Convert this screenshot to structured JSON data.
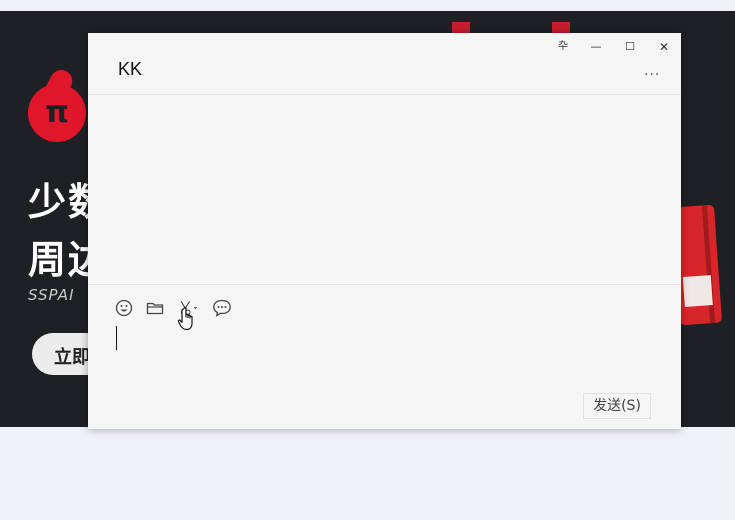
{
  "background_page": {
    "logo_glyph": "π",
    "headline_line1": "少数",
    "headline_line2": "周边",
    "brand": "SSPAI",
    "cta_label": "立即"
  },
  "chat_window": {
    "title": "KK",
    "window_controls": {
      "pin_icon": "pin-icon",
      "minimize_icon": "minimize-icon",
      "maximize_icon": "maximize-icon",
      "close_icon": "close-icon",
      "pin_glyph": "卆",
      "minimize_glyph": "—",
      "maximize_glyph": "☐",
      "close_glyph": "✕"
    },
    "more_label": "...",
    "toolbar": [
      {
        "name": "emoji-icon"
      },
      {
        "name": "folder-icon"
      },
      {
        "name": "scissors-icon"
      },
      {
        "name": "chat-bubble-icon"
      }
    ],
    "input_value": "",
    "send_label": "发送(S)"
  },
  "colors": {
    "brand_red": "#e0162b",
    "banner_bg": "#1f2024",
    "window_bg": "#f5f5f5"
  }
}
